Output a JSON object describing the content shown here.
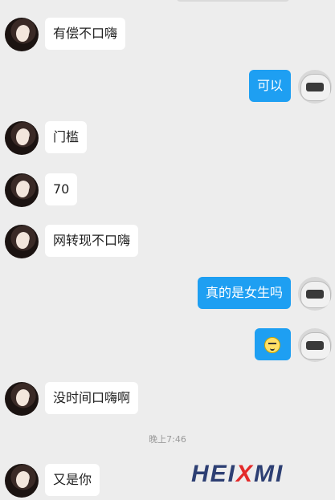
{
  "messages": [
    {
      "side": "in",
      "text": "有偿不口嗨"
    },
    {
      "side": "out",
      "text": "可以"
    },
    {
      "side": "in",
      "text": "门槛"
    },
    {
      "side": "in",
      "text": "70"
    },
    {
      "side": "in",
      "text": "网转现不口嗨"
    },
    {
      "side": "out",
      "text": "真的是女生吗"
    },
    {
      "side": "out",
      "emoji": "smile-emoji"
    },
    {
      "side": "in",
      "text": "没时间口嗨啊"
    },
    {
      "side": "in",
      "text": "又是你"
    }
  ],
  "timestamp": "晚上7:46",
  "watermark": {
    "part1": "HEI",
    "part2": "X",
    "part3": "MI",
    "accent": "#e32a2a",
    "brand": "#2d3f73"
  },
  "colors": {
    "background": "#ededed",
    "incoming_bubble": "#ffffff",
    "outgoing_bubble": "#1e9ff2"
  }
}
